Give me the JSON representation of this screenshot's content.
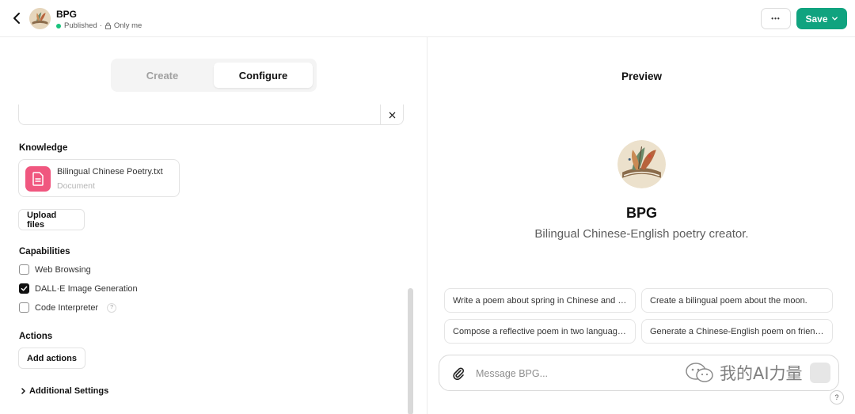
{
  "header": {
    "gpt_name": "BPG",
    "status": "Published",
    "separator": "·",
    "visibility": "Only me",
    "more_label": "•••",
    "save_label": "Save",
    "accent_color": "#10a37f"
  },
  "editor": {
    "tabs": [
      {
        "label": "Create",
        "active": false
      },
      {
        "label": "Configure",
        "active": true
      }
    ],
    "knowledge": {
      "label": "Knowledge",
      "files": [
        {
          "name": "Bilingual Chinese Poetry.txt",
          "type": "Document",
          "icon": "document-icon",
          "color": "#f0577f"
        }
      ],
      "upload_label": "Upload files"
    },
    "capabilities": {
      "label": "Capabilities",
      "items": [
        {
          "label": "Web Browsing",
          "checked": false
        },
        {
          "label": "DALL·E Image Generation",
          "checked": true
        },
        {
          "label": "Code Interpreter",
          "checked": false,
          "help": "?"
        }
      ]
    },
    "actions": {
      "label": "Actions",
      "add_label": "Add actions"
    },
    "additional_settings_label": "Additional Settings"
  },
  "preview": {
    "title": "Preview",
    "bot_name": "BPG",
    "bot_description": "Bilingual Chinese-English poetry creator.",
    "starters": [
      "Write a poem about spring in Chinese and English.",
      "Create a bilingual poem about the moon.",
      "Compose a reflective poem in two languages.",
      "Generate a Chinese-English poem on friendship."
    ],
    "composer_placeholder": "Message BPG...",
    "help_label": "?"
  },
  "watermark": {
    "text": "我的AI力量"
  }
}
